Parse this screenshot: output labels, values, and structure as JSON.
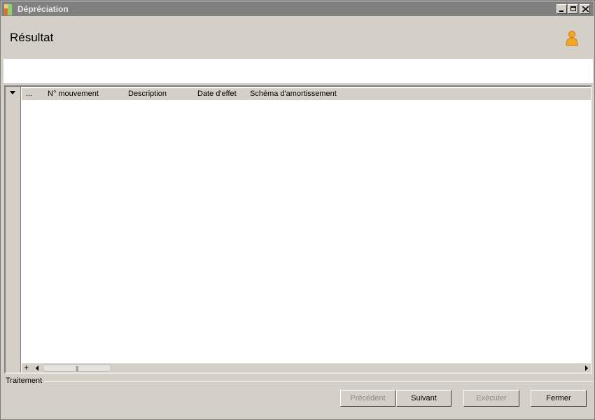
{
  "window": {
    "title": "Dépréciation"
  },
  "header": {
    "title": "Résultat",
    "user_icon": "user-icon"
  },
  "grid": {
    "columns": [
      "...",
      "N° mouvement",
      "Description",
      "Date d'effet",
      "Schéma d'amortissement"
    ],
    "rows": [],
    "footer_plus": "+",
    "scroll_grip": "|||"
  },
  "traitement": {
    "label": "Traitement"
  },
  "buttons": {
    "previous": "Précédent",
    "next": "Suivant",
    "execute": "Exécuter",
    "close": "Fermer"
  },
  "colors": {
    "titlebar": "#808080",
    "face": "#d4d0c8",
    "user_icon": "#f5a623"
  }
}
